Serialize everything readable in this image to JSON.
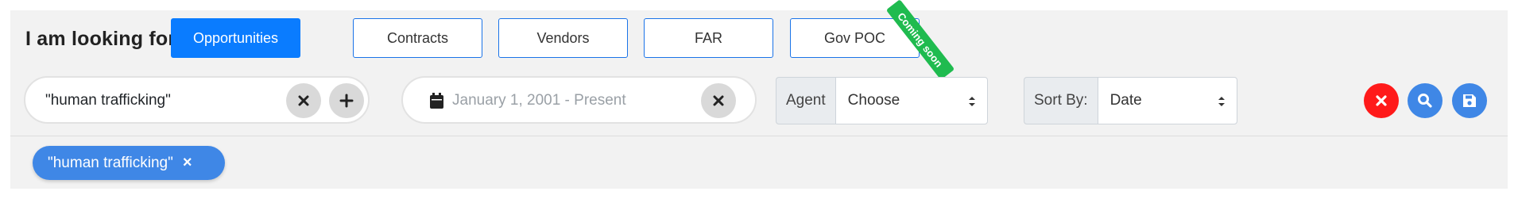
{
  "header": {
    "label": "I am looking for . . ."
  },
  "types": [
    {
      "label": "Opportunities",
      "active": true
    },
    {
      "label": "Contracts",
      "active": false
    },
    {
      "label": "Vendors",
      "active": false
    },
    {
      "label": "FAR",
      "active": false
    },
    {
      "label": "Gov POC",
      "active": false
    }
  ],
  "ribbon": {
    "label": "Coming soon",
    "color": "#1fbb4f"
  },
  "search": {
    "value": "\"human trafficking\""
  },
  "date": {
    "placeholder": "January 1, 2001 - Present"
  },
  "agent": {
    "label": "Agent",
    "selected": "Choose"
  },
  "sort": {
    "label": "Sort By:",
    "selected": "Date"
  },
  "actions": [
    {
      "name": "clear",
      "icon": "close-icon",
      "color": "#ff1a1a"
    },
    {
      "name": "search",
      "icon": "search-icon",
      "color": "#3f87e6"
    },
    {
      "name": "save",
      "icon": "save-icon",
      "color": "#3f87e6"
    }
  ],
  "tags": [
    {
      "label": "\"human trafficking\""
    }
  ],
  "colors": {
    "accent": "#0a7cff",
    "panel": "#f2f2f2"
  }
}
